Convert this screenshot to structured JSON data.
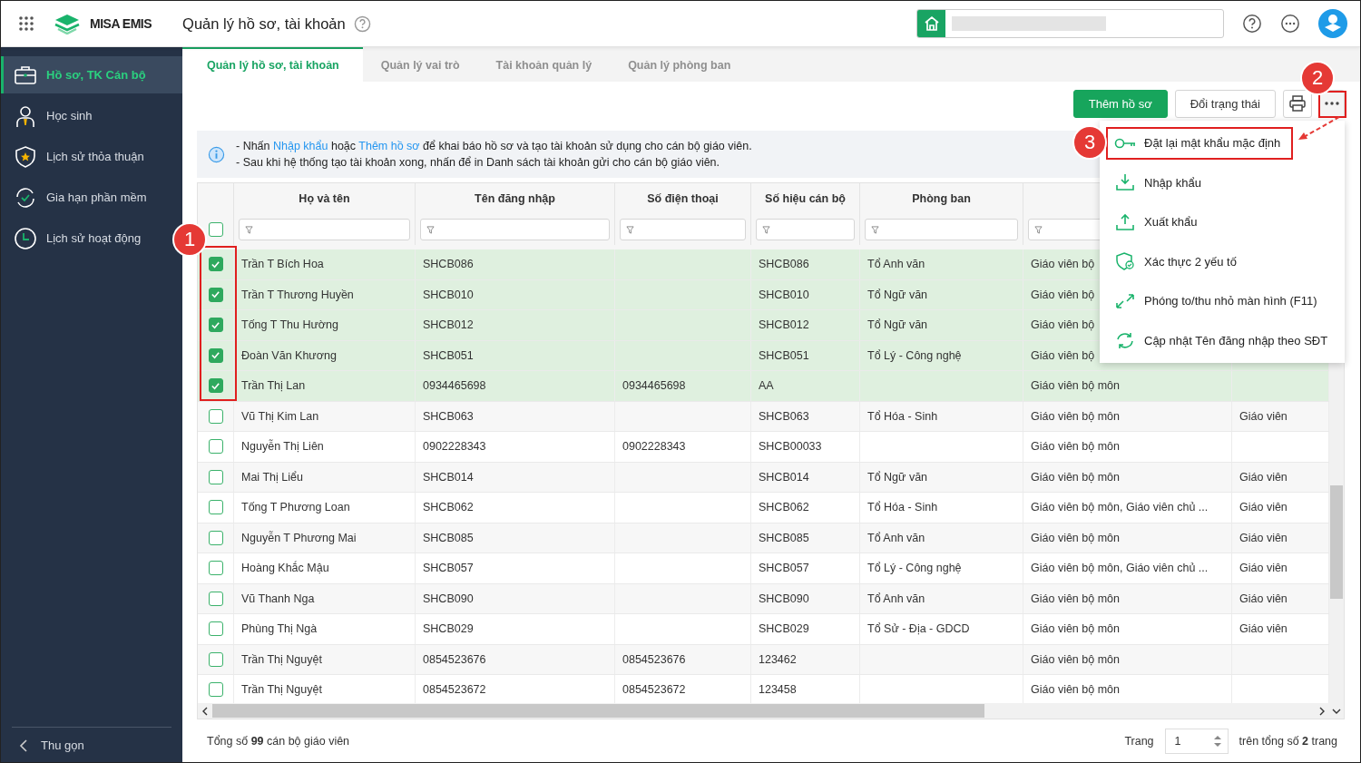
{
  "app": {
    "brand": "MISA EMIS",
    "page_title": "Quản lý hồ sơ, tài khoản"
  },
  "sidebar": {
    "items": [
      {
        "label": "Hồ sơ, TK Cán bộ",
        "selected": true
      },
      {
        "label": "Học sinh",
        "selected": false
      },
      {
        "label": "Lịch sử thỏa thuận",
        "selected": false
      },
      {
        "label": "Gia hạn phần mềm",
        "selected": false
      },
      {
        "label": "Lịch sử hoạt động",
        "selected": false
      }
    ],
    "collapse": "Thu gọn"
  },
  "tabs": [
    {
      "label": "Quản lý hồ sơ, tài khoản",
      "selected": true
    },
    {
      "label": "Quản lý vai trò",
      "selected": false
    },
    {
      "label": "Tài khoản quản lý",
      "selected": false
    },
    {
      "label": "Quản lý phòng ban",
      "selected": false
    }
  ],
  "toolbar": {
    "buttons": [
      {
        "label": "Thêm hồ sơ",
        "kind": "primary"
      },
      {
        "label": "Đổi trạng thái",
        "kind": "secondary"
      }
    ]
  },
  "notice": [
    [
      {
        "text": "- Nhấn ",
        "link": false
      },
      {
        "text": "Nhập khẩu",
        "link": true
      },
      {
        "text": " hoặc ",
        "link": false
      },
      {
        "text": "Thêm hồ sơ",
        "link": true
      },
      {
        "text": " để khai báo hồ sơ và tạo tài khoản sử dụng cho cán bộ giáo viên.",
        "link": false
      }
    ],
    [
      {
        "text": "- Sau khi hệ thống tạo tài khoản xong, nhấn để in Danh sách tài khoản gửi cho cán bộ giáo viên.",
        "link": false
      }
    ]
  ],
  "more_menu": {
    "items": [
      {
        "label": "Đặt lại mật khẩu mặc định",
        "highlighted": true
      },
      {
        "label": "Nhập khẩu",
        "highlighted": false
      },
      {
        "label": "Xuất khẩu",
        "highlighted": false
      },
      {
        "label": "Xác thực 2 yếu tố",
        "highlighted": false
      },
      {
        "label": "Phóng to/thu nhỏ màn hình (F11)",
        "highlighted": false
      },
      {
        "label": "Cập nhật Tên đăng nhập theo SĐT",
        "highlighted": false
      }
    ]
  },
  "callouts": [
    {
      "label": "1"
    },
    {
      "label": "2"
    },
    {
      "label": "3"
    }
  ],
  "table": {
    "select_all": {
      "checked": false
    },
    "columns": [
      "Họ và tên",
      "Tên đăng nhập",
      "Số điện thoại",
      "Số hiệu cán bộ",
      "Phòng ban"
    ],
    "rows": [
      {
        "checked": true,
        "cells": [
          "Trần T Bích Hoa",
          "SHCB086",
          "",
          "SHCB086",
          "Tổ Anh văn",
          "Giáo viên bộ",
          ""
        ]
      },
      {
        "checked": true,
        "cells": [
          "Trần T Thương Huyền",
          "SHCB010",
          "",
          "SHCB010",
          "Tổ Ngữ văn",
          "Giáo viên bộ",
          ""
        ]
      },
      {
        "checked": true,
        "cells": [
          "Tống T Thu Hường",
          "SHCB012",
          "",
          "SHCB012",
          "Tổ Ngữ văn",
          "Giáo viên bộ",
          ""
        ]
      },
      {
        "checked": true,
        "cells": [
          "Đoàn Văn Khương",
          "SHCB051",
          "",
          "SHCB051",
          "Tổ Lý - Công nghệ",
          "Giáo viên bộ",
          ""
        ]
      },
      {
        "checked": true,
        "cells": [
          "Trần Thị Lan",
          "0934465698",
          "0934465698",
          "AA",
          "",
          "Giáo viên bộ môn",
          ""
        ]
      },
      {
        "checked": false,
        "cells": [
          "Vũ Thị Kim Lan",
          "SHCB063",
          "",
          "SHCB063",
          "Tổ Hóa - Sinh",
          "Giáo viên bộ môn",
          "Giáo viên"
        ]
      },
      {
        "checked": false,
        "cells": [
          "Nguyễn Thị Liên",
          "0902228343",
          "0902228343",
          "SHCB00033",
          "",
          "Giáo viên bộ môn",
          ""
        ]
      },
      {
        "checked": false,
        "cells": [
          "Mai Thị Liểu",
          "SHCB014",
          "",
          "SHCB014",
          "Tổ Ngữ văn",
          "Giáo viên bộ môn",
          "Giáo viên"
        ]
      },
      {
        "checked": false,
        "cells": [
          "Tống T Phương Loan",
          "SHCB062",
          "",
          "SHCB062",
          "Tổ Hóa - Sinh",
          "Giáo viên bộ môn, Giáo viên chủ ...",
          "Giáo viên"
        ]
      },
      {
        "checked": false,
        "cells": [
          "Nguyễn T Phương Mai",
          "SHCB085",
          "",
          "SHCB085",
          "Tổ Anh văn",
          "Giáo viên bộ môn",
          "Giáo viên"
        ]
      },
      {
        "checked": false,
        "cells": [
          "Hoàng Khắc Mậu",
          "SHCB057",
          "",
          "SHCB057",
          "Tổ Lý - Công nghệ",
          "Giáo viên bộ môn, Giáo viên chủ ...",
          "Giáo viên"
        ]
      },
      {
        "checked": false,
        "cells": [
          "Vũ Thanh Nga",
          "SHCB090",
          "",
          "SHCB090",
          "Tổ Anh văn",
          "Giáo viên bộ môn",
          "Giáo viên"
        ]
      },
      {
        "checked": false,
        "cells": [
          "Phùng Thị Ngà",
          "SHCB029",
          "",
          "SHCB029",
          "Tổ Sử - Địa - GDCD",
          "Giáo viên bộ môn",
          "Giáo viên"
        ]
      },
      {
        "checked": false,
        "cells": [
          "Trần Thị Nguyệt",
          "0854523676",
          "0854523676",
          "123462",
          "",
          "Giáo viên bộ môn",
          ""
        ]
      },
      {
        "checked": false,
        "cells": [
          "Trần Thị Nguyệt",
          "0854523672",
          "0854523672",
          "123458",
          "",
          "Giáo viên bộ môn",
          ""
        ]
      }
    ]
  },
  "footer": {
    "total": "Tổng số **99** cán bộ giáo viên",
    "page_label": "Trang",
    "page": "1",
    "pages": "trên tổng số **2** trang"
  }
}
